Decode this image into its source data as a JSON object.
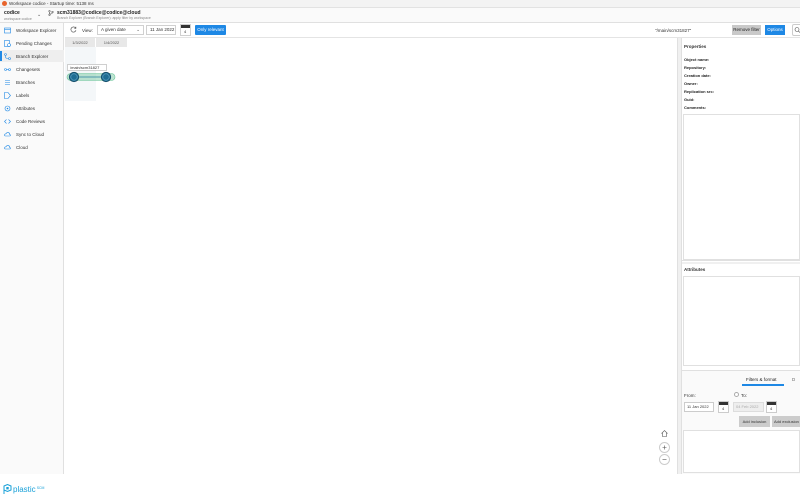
{
  "window": {
    "title": "Workspace codice - Startup time: 5138 ms"
  },
  "workspace": {
    "name": "codice",
    "subtitle": "workspace:codice"
  },
  "repository": {
    "name": "scm31883@codice@codice@cloud",
    "subtitle": "Branch Explorer (Branch Explorer): apply filter by workspace"
  },
  "sidebar": {
    "items": [
      {
        "label": "Workspace Explorer",
        "icon": "workspace-explorer-icon"
      },
      {
        "label": "Pending Changes",
        "icon": "pending-changes-icon"
      },
      {
        "label": "Branch Explorer",
        "icon": "branch-explorer-icon",
        "active": true
      },
      {
        "label": "Changesets",
        "icon": "changesets-icon"
      },
      {
        "label": "Branches",
        "icon": "branches-icon"
      },
      {
        "label": "Labels",
        "icon": "labels-icon"
      },
      {
        "label": "Attributes",
        "icon": "attributes-icon"
      },
      {
        "label": "Code Reviews",
        "icon": "code-reviews-icon"
      },
      {
        "label": "Sync to Cloud",
        "icon": "sync-to-cloud-icon"
      },
      {
        "label": "Cloud",
        "icon": "cloud-icon"
      }
    ],
    "logo_text": "plastic",
    "logo_sub": "SCM"
  },
  "toolbar": {
    "view_label": "View:",
    "view_select": "A given date",
    "date_value": "11 Jan 2022",
    "calendar_day": "4",
    "only_relevant": "Only relevant",
    "branch_chip": "\"/main/scm31827\"",
    "remove_filter": "Remove filter",
    "options": "Options"
  },
  "graph": {
    "date_columns": [
      "1/3/2022",
      "1/4/2022"
    ],
    "branch_label": "/main/scm31827"
  },
  "properties": {
    "title": "Properties",
    "rows": [
      "Object name:",
      "Repository:",
      "Creation date:",
      "Owner:",
      "Replication src:",
      "Guid:",
      "Comments:"
    ]
  },
  "attributes": {
    "title": "Attributes"
  },
  "filters": {
    "tab_filter": "Filters & format",
    "tab_info": "D",
    "from_label": "From:",
    "to_label": "To:",
    "from_date": "11 Jan 2022",
    "to_date": "04 Feb 2022",
    "from_cal_day": "4",
    "to_cal_day": "4",
    "add_inclusion": "Add inclusion",
    "add_exclusion": "Add exclusion"
  },
  "colors": {
    "accent": "#1e88e5",
    "branch_fill": "#6cc49a",
    "changeset": "#1f6d93"
  }
}
